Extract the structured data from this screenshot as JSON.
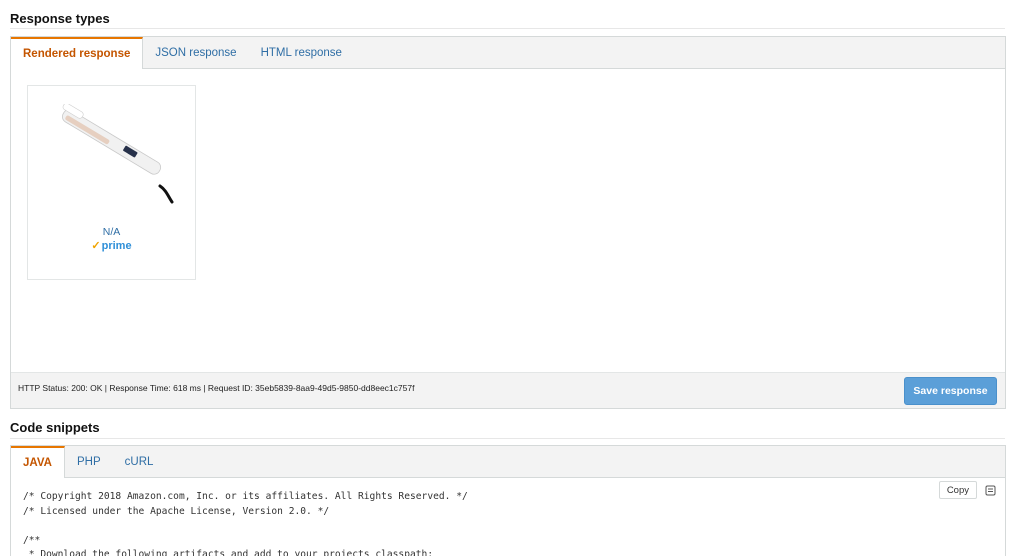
{
  "response_types": {
    "title": "Response types",
    "tabs": [
      {
        "label": "Rendered response"
      },
      {
        "label": "JSON response"
      },
      {
        "label": "HTML response"
      }
    ],
    "product": {
      "image": "hair-straightener-image",
      "price": "N/A",
      "prime_check": "✓",
      "prime_label": "prime"
    },
    "status_text": "HTTP Status: 200: OK | Response Time: 618 ms | Request ID: 35eb5839-8aa9-49d5-9850-dd8eec1c757f",
    "save_label": "Save response"
  },
  "code_snippets": {
    "title": "Code snippets",
    "tabs": [
      {
        "label": "JAVA"
      },
      {
        "label": "PHP"
      },
      {
        "label": "cURL"
      }
    ],
    "copy_label": "Copy",
    "code": "/* Copyright 2018 Amazon.com, Inc. or its affiliates. All Rights Reserved. */\n/* Licensed under the Apache License, Version 2.0. */\n\n/**\n * Download the following artifacts and add to your projects classpath:"
  },
  "colors": {
    "active_tab": "#c45500",
    "link": "#2f6ea5",
    "save_button": "#5b9fd8",
    "prime": "#2f8fd8"
  }
}
